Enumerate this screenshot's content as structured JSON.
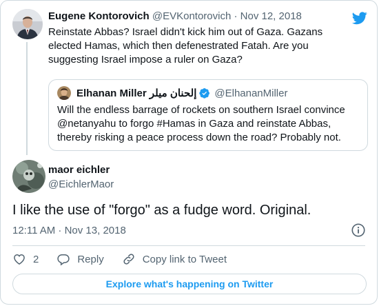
{
  "parent_tweet": {
    "name": "Eugene Kontorovich",
    "handle": "@EVKontorovich",
    "date": "Nov 12, 2018",
    "separator": " · ",
    "text": "Reinstate Abbas? Israel didn't kick him out of Gaza. Gazans elected Hamas, which then defenestrated Fatah. Are you suggesting Israel impose a ruler on Gaza?"
  },
  "quoted_tweet": {
    "name": "Elhanan Miller إلحنان ميلر",
    "handle": "@ElhananMiller",
    "text": "Will the endless barrage of rockets on southern Israel convince @netanyahu to forgo #Hamas in Gaza and reinstate Abbas, thereby risking a peace process down the road? Probably not."
  },
  "reply_tweet": {
    "name": "maor eichler",
    "handle": "@EichlerMaor",
    "text": "I like the use of \"forgo\" as a fudge word. Original.",
    "timestamp": "12:11 AM · Nov 13, 2018"
  },
  "actions": {
    "like_count": "2",
    "reply_label": "Reply",
    "copy_label": "Copy link to Tweet"
  },
  "explore_label": "Explore what's happening on Twitter",
  "colors": {
    "accent": "#1d9bf0",
    "text": "#0f1419",
    "muted": "#536471",
    "border": "#cfd9de"
  },
  "icons": [
    "twitter-bird-icon",
    "verified-badge-icon",
    "info-icon",
    "heart-icon",
    "reply-icon",
    "link-icon"
  ]
}
